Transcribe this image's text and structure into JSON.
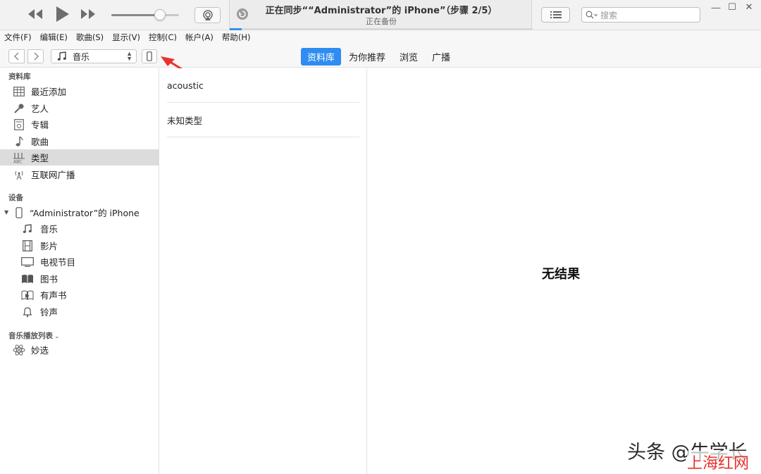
{
  "window": {
    "title": "正在同步““Administrator”的 iPhone”（步骤 2/5）",
    "subtitle": "正在备份",
    "sync_progress": 0.04,
    "volume": 0.72
  },
  "search": {
    "placeholder": "搜索",
    "icon": "search-icon"
  },
  "window_controls": [
    "—",
    "☐",
    "✕"
  ],
  "menu": [
    "文件(F)",
    "编辑(E)",
    "歌曲(S)",
    "显示(V)",
    "控制(C)",
    "帐户(A)",
    "帮助(H)"
  ],
  "nav": {
    "media_label": "音乐",
    "tabs": [
      {
        "label": "资料库",
        "active": true
      },
      {
        "label": "为你推荐",
        "active": false
      },
      {
        "label": "浏览",
        "active": false
      },
      {
        "label": "广播",
        "active": false
      }
    ]
  },
  "sidebar": {
    "library_header": "资料库",
    "library_items": [
      {
        "label": "最近添加",
        "icon": "grid-icon"
      },
      {
        "label": "艺人",
        "icon": "microphone-icon"
      },
      {
        "label": "专辑",
        "icon": "album-icon"
      },
      {
        "label": "歌曲",
        "icon": "music-note-icon"
      },
      {
        "label": "类型",
        "icon": "genre-icon",
        "selected": true
      },
      {
        "label": "互联网广播",
        "icon": "radio-antenna-icon"
      }
    ],
    "devices_header": "设备",
    "device_name": "“Administrator”的 iPhone",
    "device_items": [
      {
        "label": "音乐",
        "icon": "music-note-icon"
      },
      {
        "label": "影片",
        "icon": "film-icon"
      },
      {
        "label": "电视节目",
        "icon": "tv-icon"
      },
      {
        "label": "图书",
        "icon": "book-icon"
      },
      {
        "label": "有声书",
        "icon": "audiobook-icon"
      },
      {
        "label": "铃声",
        "icon": "bell-icon"
      }
    ],
    "playlists_header": "音乐播放列表",
    "playlist_items": [
      {
        "label": "妙选",
        "icon": "atom-icon"
      }
    ]
  },
  "genres": [
    "acoustic",
    "未知类型"
  ],
  "main": {
    "empty_text": "无结果"
  },
  "watermark": {
    "line1": "头条 @牛学长",
    "line2": "上海红网"
  },
  "colors": {
    "accent": "#2f8cf0",
    "annotation_arrow": "#e8322c",
    "selected_row": "#dcdcdc"
  }
}
